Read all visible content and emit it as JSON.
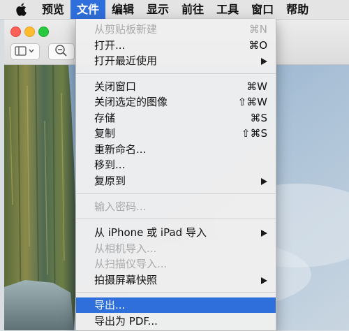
{
  "menubar": {
    "items": [
      "预览",
      "文件",
      "编辑",
      "显示",
      "前往",
      "工具",
      "窗口",
      "帮助"
    ]
  },
  "file_menu": {
    "items": [
      {
        "label": "从剪贴板新建",
        "shortcut": "⌘N"
      },
      {
        "label": "打开...",
        "shortcut": "⌘O"
      },
      {
        "label": "打开最近使用"
      },
      {
        "label": "关闭窗口",
        "shortcut": "⌘W"
      },
      {
        "label": "关闭选定的图像",
        "shortcut": "⇧⌘W"
      },
      {
        "label": "存储",
        "shortcut": "⌘S"
      },
      {
        "label": "复制",
        "shortcut": "⇧⌘S"
      },
      {
        "label": "重新命名..."
      },
      {
        "label": "移到..."
      },
      {
        "label": "复原到"
      },
      {
        "label": "输入密码..."
      },
      {
        "label": "从 iPhone 或 iPad 导入"
      },
      {
        "label": "从相机导入..."
      },
      {
        "label": "从扫描仪导入..."
      },
      {
        "label": "拍摄屏幕快照"
      },
      {
        "label": "导出..."
      },
      {
        "label": "导出为 PDF..."
      }
    ]
  }
}
